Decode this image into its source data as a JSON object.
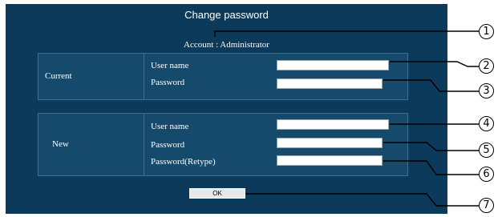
{
  "dialog": {
    "title": "Change password",
    "account_text": "Account : Administrator"
  },
  "current": {
    "group_label": "Current",
    "username_label": "User name",
    "password_label": "Password",
    "username_value": "",
    "password_value": ""
  },
  "new": {
    "group_label": "New",
    "username_label": "User name",
    "password_label": "Password",
    "retype_label": "Password(Retype)",
    "username_value": "",
    "password_value": "",
    "retype_value": ""
  },
  "ok_button": {
    "label": "OK"
  },
  "callouts": [
    "1",
    "2",
    "3",
    "4",
    "5",
    "6",
    "7"
  ],
  "colors": {
    "panel_bg": "#0b3a5a",
    "group_bg": "#154a6c",
    "border": "#3f6f8f"
  }
}
